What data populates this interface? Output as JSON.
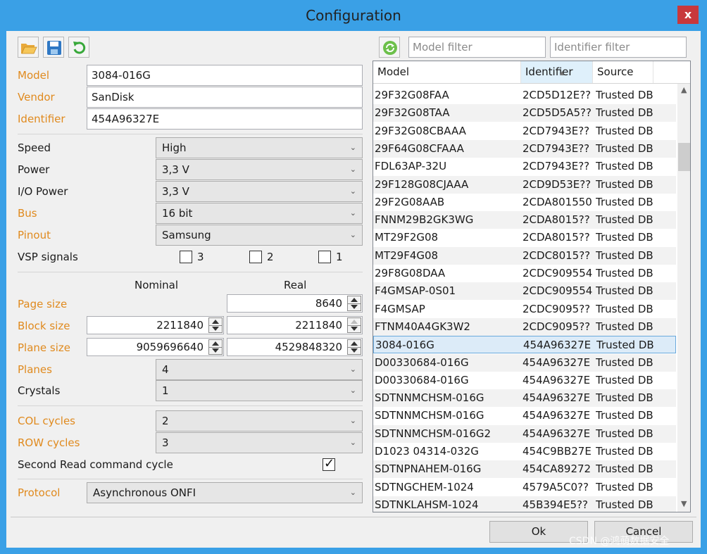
{
  "window": {
    "title": "Configuration",
    "close_label": "x"
  },
  "toolbar_left": {
    "open_icon": "open-folder-icon",
    "save_icon": "save-disk-icon",
    "reload_icon": "reload-icon"
  },
  "identity": {
    "model_label": "Model",
    "model_value": "3084-016G",
    "vendor_label": "Vendor",
    "vendor_value": "SanDisk",
    "identifier_label": "Identifier",
    "identifier_value": "454A96327E"
  },
  "electrical": {
    "speed_label": "Speed",
    "speed_value": "High",
    "power_label": "Power",
    "power_value": "3,3 V",
    "io_power_label": "I/O Power",
    "io_power_value": "3,3 V",
    "bus_label": "Bus",
    "bus_value": "16 bit",
    "pinout_label": "Pinout",
    "pinout_value": "Samsung",
    "vsp_label": "VSP signals",
    "vsp_options": [
      {
        "label": "3",
        "checked": false
      },
      {
        "label": "2",
        "checked": false
      },
      {
        "label": "1",
        "checked": false
      }
    ]
  },
  "geometry": {
    "nominal_header": "Nominal",
    "real_header": "Real",
    "page_size_label": "Page size",
    "page_size_real": "8640",
    "block_size_label": "Block size",
    "block_size_nominal": "2211840",
    "block_size_real": "2211840",
    "plane_size_label": "Plane size",
    "plane_size_nominal": "9059696640",
    "plane_size_real": "4529848320",
    "planes_label": "Planes",
    "planes_value": "4",
    "crystals_label": "Crystals",
    "crystals_value": "1"
  },
  "cycles": {
    "col_label": "COL cycles",
    "col_value": "2",
    "row_label": "ROW cycles",
    "row_value": "3",
    "second_read_label": "Second Read command cycle",
    "second_read_checked": true
  },
  "protocol": {
    "label": "Protocol",
    "value": "Asynchronous ONFI"
  },
  "right": {
    "refresh_icon": "refresh-icon",
    "model_filter_placeholder": "Model filter",
    "identifier_filter_placeholder": "Identifier filter",
    "columns": [
      "Model",
      "Identifier",
      "Source"
    ],
    "selected_index": 14,
    "rows": [
      [
        "29F32G08FAA",
        "2CD5D12E??",
        "Trusted DB"
      ],
      [
        "29F32G08TAA",
        "2CD5D5A5??",
        "Trusted DB"
      ],
      [
        "29F32G08CBAAA",
        "2CD7943E??",
        "Trusted DB"
      ],
      [
        "29F64G08CFAAA",
        "2CD7943E??",
        "Trusted DB"
      ],
      [
        "FDL63AP-32U",
        "2CD7943E??",
        "Trusted DB"
      ],
      [
        "29F128G08CJAAA",
        "2CD9D53E??",
        "Trusted DB"
      ],
      [
        "29F2G08AAB",
        "2CDA801550",
        "Trusted DB"
      ],
      [
        "FNNM29B2GK3WG",
        "2CDA8015??",
        "Trusted DB"
      ],
      [
        "MT29F2G08",
        "2CDA8015??",
        "Trusted DB"
      ],
      [
        "MT29F4G08",
        "2CDC8015??",
        "Trusted DB"
      ],
      [
        "29F8G08DAA",
        "2CDC909554",
        "Trusted DB"
      ],
      [
        "F4GMSAP-0S01",
        "2CDC909554",
        "Trusted DB"
      ],
      [
        "F4GMSAP",
        "2CDC9095??",
        "Trusted DB"
      ],
      [
        "FTNM40A4GK3W2",
        "2CDC9095??",
        "Trusted DB"
      ],
      [
        "3084-016G",
        "454A96327E",
        "Trusted DB"
      ],
      [
        "D00330684-016G",
        "454A96327E",
        "Trusted DB"
      ],
      [
        "D00330684-016G",
        "454A96327E",
        "Trusted DB"
      ],
      [
        "SDTNNMCHSM-016G",
        "454A96327E",
        "Trusted DB"
      ],
      [
        "SDTNNMCHSM-016G",
        "454A96327E",
        "Trusted DB"
      ],
      [
        "SDTNNMCHSM-016G2",
        "454A96327E",
        "Trusted DB"
      ],
      [
        "D1023 04314-032G",
        "454C9BB27E",
        "Trusted DB"
      ],
      [
        "SDTNPNAHEM-016G",
        "454CA89272",
        "Trusted DB"
      ],
      [
        "SDTNGCHEM-1024",
        "4579A5C0??",
        "Trusted DB"
      ],
      [
        "SDTNKLAHSM-1024",
        "45B394E5??",
        "Trusted DB"
      ]
    ]
  },
  "footer": {
    "ok_label": "Ok",
    "cancel_label": "Cancel",
    "watermark": "CSDN @鸿萌数据安全"
  }
}
